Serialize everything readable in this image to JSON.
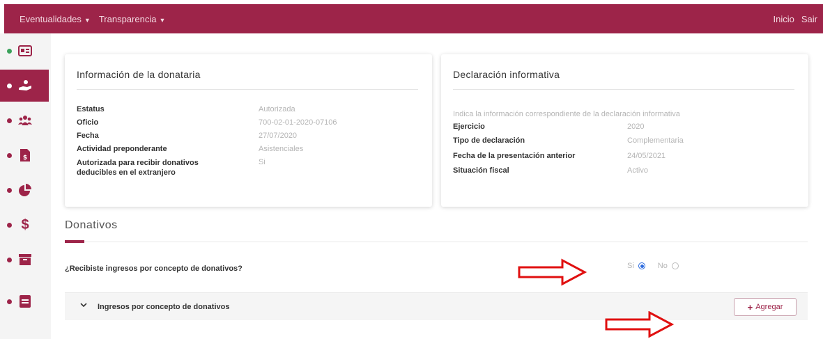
{
  "colors": {
    "brand": "#9d2449",
    "accent_radio": "#2d6cdf",
    "arrow": "#e01010"
  },
  "nav": {
    "menu": [
      {
        "label": "Eventualidades"
      },
      {
        "label": "Transparencia"
      }
    ],
    "right": [
      {
        "label": "Inicio"
      },
      {
        "label": "Sair"
      }
    ]
  },
  "sidebar": {
    "items": [
      {
        "icon": "id-card-icon",
        "active": false
      },
      {
        "icon": "donation-hand-icon",
        "active": true
      },
      {
        "icon": "people-icon",
        "active": false
      },
      {
        "icon": "document-dollar-icon",
        "active": false
      },
      {
        "icon": "pie-chart-icon",
        "active": false
      },
      {
        "icon": "dollar-icon",
        "active": false
      },
      {
        "icon": "archive-icon",
        "active": false
      },
      {
        "icon": "folder-icon",
        "active": false
      }
    ]
  },
  "donataria": {
    "title": "Información de la donataria",
    "rows": [
      {
        "label": "Estatus",
        "value": "Autorizada"
      },
      {
        "label": "Oficio",
        "value": "700-02-01-2020-07106"
      },
      {
        "label": "Fecha",
        "value": "27/07/2020"
      },
      {
        "label": "Actividad preponderante",
        "value": "Asistenciales"
      },
      {
        "label": "Autorizada para recibir donativos deducibles en el extranjero",
        "value": "Si"
      }
    ]
  },
  "declaracion": {
    "title": "Declaración informativa",
    "subtitle": "Indica la información correspondiente de la declaración informativa",
    "rows": [
      {
        "label": "Ejercicio",
        "value": "2020"
      },
      {
        "label": "Tipo de declaración",
        "value": "Complementaria"
      },
      {
        "label": "Fecha de la presentación anterior",
        "value": "24/05/2021"
      },
      {
        "label": "Situación fiscal",
        "value": "Activo"
      }
    ]
  },
  "donativos": {
    "title": "Donativos",
    "question": "¿Recibiste ingresos por concepto de donativos?",
    "yes_label": "Si",
    "no_label": "No",
    "selected": "Si",
    "accordion_title": "Ingresos por concepto de donativos",
    "add_label": "Agregar"
  }
}
